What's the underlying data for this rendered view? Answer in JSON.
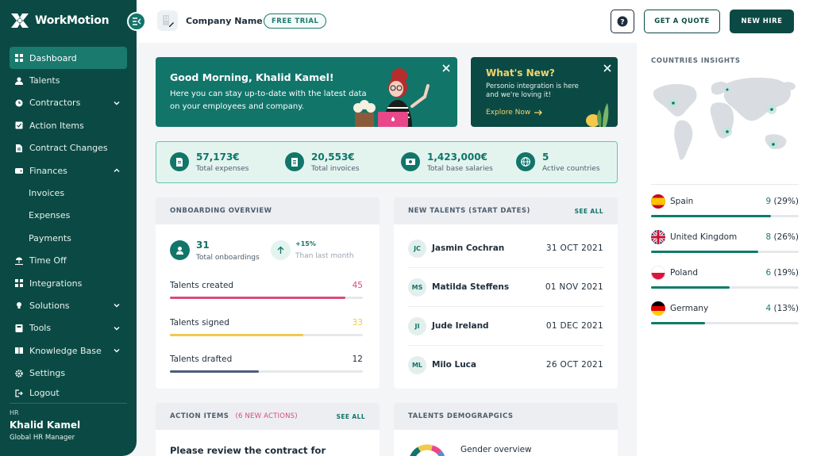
{
  "app": {
    "name": "WorkMotion"
  },
  "sidebar": {
    "items": [
      {
        "label": "Dashboard"
      },
      {
        "label": "Talents"
      },
      {
        "label": "Contractors"
      },
      {
        "label": "Action Items"
      },
      {
        "label": "Contract Changes"
      },
      {
        "label": "Finances"
      },
      {
        "label": "Invoices"
      },
      {
        "label": "Expenses"
      },
      {
        "label": "Payments"
      },
      {
        "label": "Time Off"
      },
      {
        "label": "Integrations"
      },
      {
        "label": "Solutions"
      },
      {
        "label": "Tools"
      },
      {
        "label": "Knowledge Base"
      },
      {
        "label": "Settings"
      },
      {
        "label": "Logout"
      }
    ],
    "user": {
      "role": "HR",
      "name": "Khalid Kamel",
      "title": "Global HR Manager"
    }
  },
  "header": {
    "company_name": "Company Name",
    "badge": "FREE TRIAL",
    "help_label": "?",
    "quote_label": "GET A QUOTE",
    "hire_label": "NEW HIRE"
  },
  "greeting": {
    "title": "Good Morning, Khalid Kamel!",
    "text": "Here you can stay up-to-date with the latest data on your employees and company."
  },
  "whats_new": {
    "title": "What's New?",
    "text": "Personio integration is here and we're loving it!",
    "link": "Explore Now"
  },
  "stats": [
    {
      "value": "57,173€",
      "label": "Total expenses"
    },
    {
      "value": "20,553€",
      "label": "Total invoices"
    },
    {
      "value": "1,423,000€",
      "label": "Total base salaries"
    },
    {
      "value": "5",
      "label": "Active countries"
    }
  ],
  "onboarding": {
    "title": "ONBOARDING OVERVIEW",
    "total_value": "31",
    "total_label": "Total onboardings",
    "change_value": "+15%",
    "change_label": "Than last month",
    "rows": [
      {
        "label": "Talents created",
        "value": "45",
        "fraction": 0.91,
        "color": "#d84b7e"
      },
      {
        "label": "Talents signed",
        "value": "33",
        "fraction": 0.69,
        "color": "#f2c94c"
      },
      {
        "label": "Talents drafted",
        "value": "12",
        "fraction": 0.46,
        "color": "#4e5b7a"
      }
    ]
  },
  "new_talents": {
    "title": "NEW TALENTS (START DATES)",
    "see_all": "SEE ALL",
    "rows": [
      {
        "initials": "JC",
        "name": "Jasmin Cochran",
        "date": "31 OCT 2021"
      },
      {
        "initials": "MS",
        "name": "Matilda Steffens",
        "date": "01 NOV 2021"
      },
      {
        "initials": "JI",
        "name": "Jude Ireland",
        "date": "01 DEC 2021"
      },
      {
        "initials": "ML",
        "name": "Milo Luca",
        "date": "26 OCT 2021"
      }
    ]
  },
  "action_items": {
    "title": "ACTION ITEMS",
    "subtitle": "(6 NEW ACTIONS)",
    "see_all": "SEE ALL",
    "text": "Please review the contract for"
  },
  "demographics": {
    "title": "TALENTS DEMOGRAPGICS",
    "text": "Gender overview"
  },
  "insights": {
    "title": "COUNTRIES INSIGHTS",
    "countries": [
      {
        "name": "Spain",
        "count": "9",
        "pct": "(29%)",
        "fraction": 0.29
      },
      {
        "name": "United Kingdom",
        "count": "8",
        "pct": "(26%)",
        "fraction": 0.26
      },
      {
        "name": "Poland",
        "count": "6",
        "pct": "(19%)",
        "fraction": 0.19
      },
      {
        "name": "Germany",
        "count": "4",
        "pct": "(13%)",
        "fraction": 0.13
      }
    ]
  },
  "colors": {
    "primary": "#0b4a44",
    "accent": "#11756a",
    "pink": "#d84b7e",
    "yellow": "#f2c94c"
  }
}
